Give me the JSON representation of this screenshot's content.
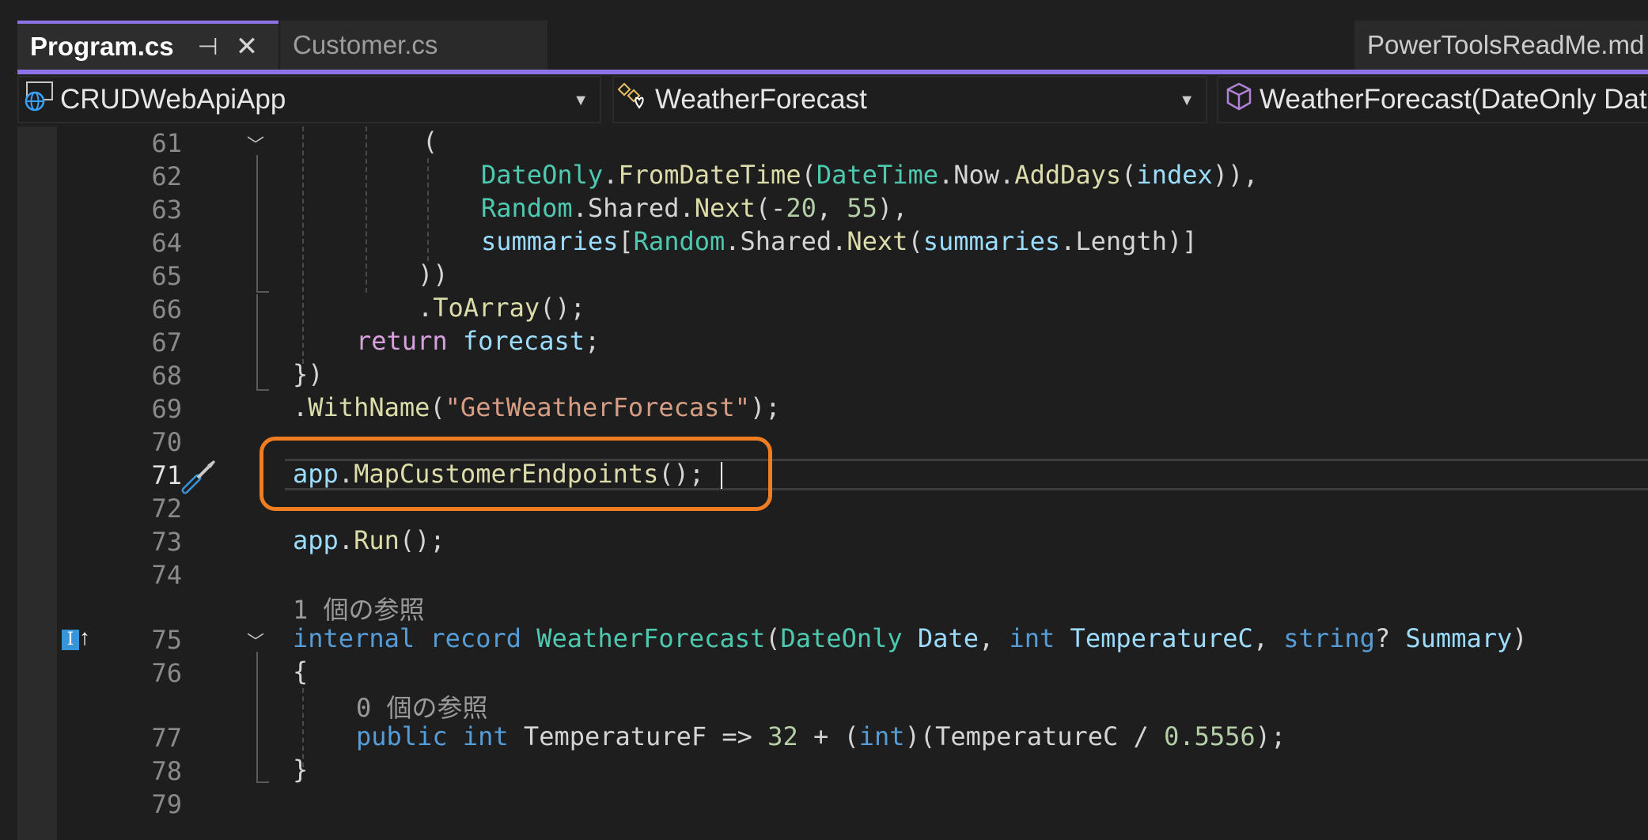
{
  "tabs": {
    "active": {
      "label": "Program.cs",
      "pin_icon": "pin-icon",
      "close_icon": "close-icon"
    },
    "second": {
      "label": "Customer.cs"
    },
    "right": {
      "label": "PowerToolsReadMe.md"
    }
  },
  "nav": {
    "project": {
      "label": "CRUDWebApiApp",
      "icon": "globe-project-icon"
    },
    "class": {
      "label": "WeatherForecast",
      "icon": "record-type-icon"
    },
    "member": {
      "label": "WeatherForecast(DateOnly Date",
      "icon": "cube-member-icon"
    }
  },
  "editor": {
    "line_numbers": [
      "61",
      "62",
      "63",
      "64",
      "65",
      "66",
      "67",
      "68",
      "69",
      "70",
      "71",
      "72",
      "73",
      "74",
      "75",
      "76",
      "77",
      "78",
      "79"
    ],
    "active_line": "71",
    "references": {
      "record": "1 個の参照",
      "property": "0 個の参照"
    }
  },
  "colors": {
    "highlight": "#f07d22",
    "accent": "#8d73e8",
    "background": "#1e1e1e"
  }
}
